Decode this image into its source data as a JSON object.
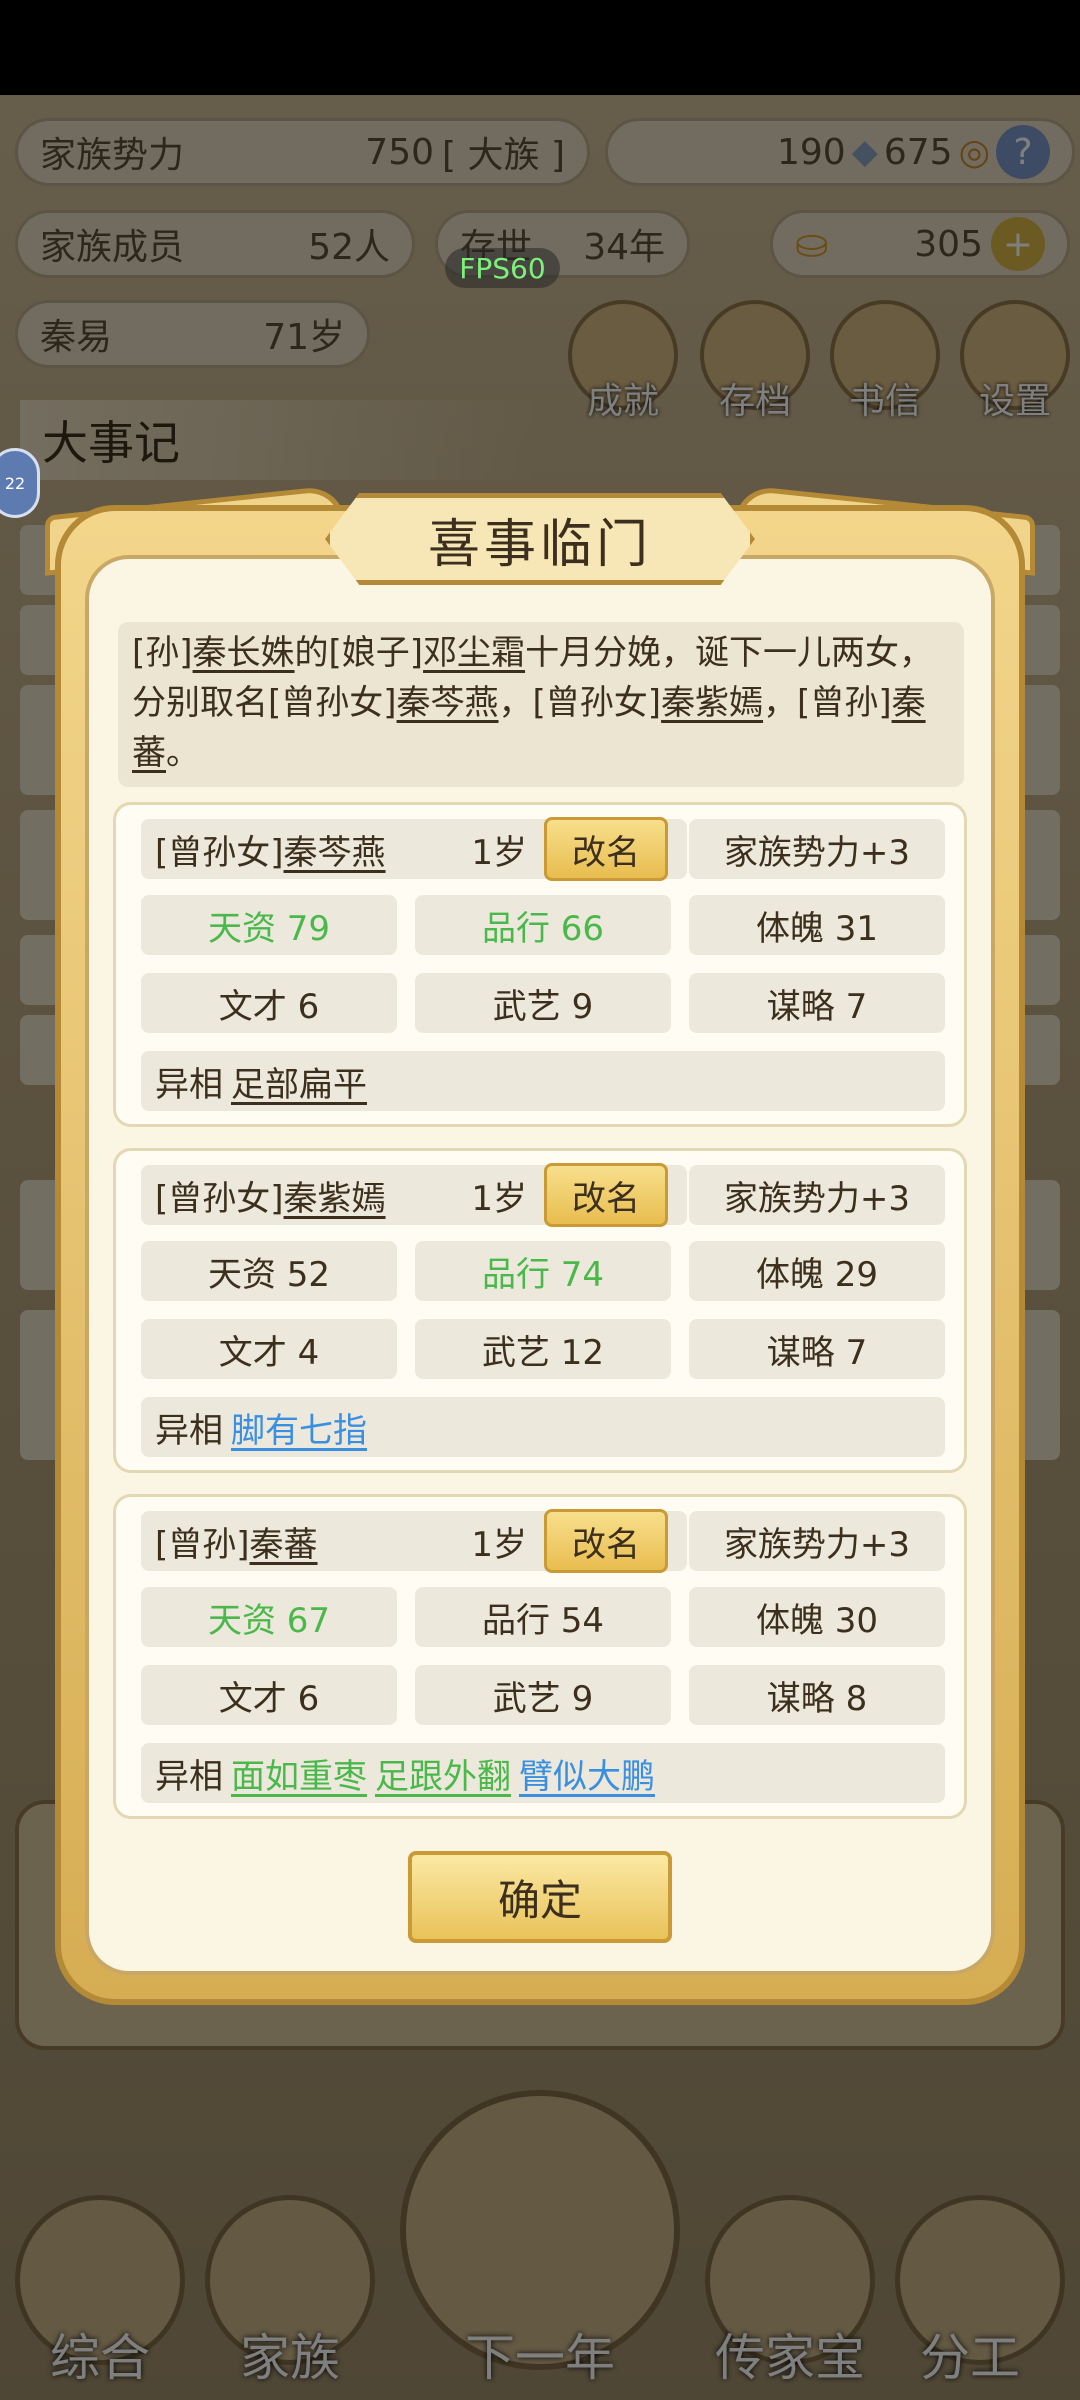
{
  "hud": {
    "clan_power_label": "家族势力",
    "clan_power_value": "750",
    "clan_power_rank": "[ 大族 ]",
    "silver": "190",
    "coins": "675",
    "help": "?",
    "members_label": "家族成员",
    "members_value": "52人",
    "existence_label": "存世",
    "existence_value": "34年",
    "gold": "305",
    "gold_add": "+",
    "leader_name": "秦易",
    "leader_age": "71岁",
    "fps": "FPS60",
    "side_badge": "22"
  },
  "top_buttons": [
    {
      "label": "成就",
      "icon": "achievement-icon"
    },
    {
      "label": "存档",
      "icon": "save-icon"
    },
    {
      "label": "书信",
      "icon": "letter-icon"
    },
    {
      "label": "设置",
      "icon": "settings-icon"
    }
  ],
  "background": {
    "section_title": "大事记"
  },
  "bottom_nav": [
    {
      "label": "综合",
      "icon": "scroll-icon"
    },
    {
      "label": "家族",
      "icon": "house-icon"
    },
    {
      "label": "下一年",
      "icon": "mountain-icon"
    },
    {
      "label": "传家宝",
      "icon": "treasure-icon"
    },
    {
      "label": "分工",
      "icon": "worker-icon"
    }
  ],
  "dialog": {
    "title": "喜事临门",
    "message": {
      "p1": "[孙]",
      "father": "秦长姝",
      "p2": "的[娘子]",
      "mother": "邓尘霜",
      "p3": "十月分娩，诞下一儿两女，分别取名[曾孙女]",
      "c1": "秦芩燕",
      "p4": "，[曾孙女]",
      "c2": "秦紫嫣",
      "p5": "，[曾孙]",
      "c3": "秦蕃",
      "p6": "。"
    },
    "rename_label": "改名",
    "trait_label": "异相",
    "confirm_label": "确定",
    "children": [
      {
        "relation": "[曾孙女]",
        "name": "秦芩燕",
        "age": "1岁",
        "power": "家族势力+3",
        "talent": "天资 79",
        "conduct": "品行 66",
        "physique": "体魄 31",
        "literary": "文才 6",
        "martial": "武艺 9",
        "strategy": "谋略 7",
        "traits": [
          {
            "text": "足部扁平",
            "color": "#3d2f1d"
          }
        ]
      },
      {
        "relation": "[曾孙女]",
        "name": "秦紫嫣",
        "age": "1岁",
        "power": "家族势力+3",
        "talent": "天资 52",
        "conduct": "品行 74",
        "physique": "体魄 29",
        "literary": "文才 4",
        "martial": "武艺 12",
        "strategy": "谋略 7",
        "traits": [
          {
            "text": "脚有七指",
            "color": "#3b8fe0"
          }
        ]
      },
      {
        "relation": "[曾孙]",
        "name": "秦蕃",
        "age": "1岁",
        "power": "家族势力+3",
        "talent": "天资 67",
        "conduct": "品行 54",
        "physique": "体魄 30",
        "literary": "文才 6",
        "martial": "武艺 9",
        "strategy": "谋略 8",
        "traits": [
          {
            "text": "面如重枣",
            "color": "#4bb84b"
          },
          {
            "text": "足跟外翻",
            "color": "#4bb84b"
          },
          {
            "text": "臂似大鹏",
            "color": "#3b8fe0"
          }
        ]
      }
    ]
  }
}
